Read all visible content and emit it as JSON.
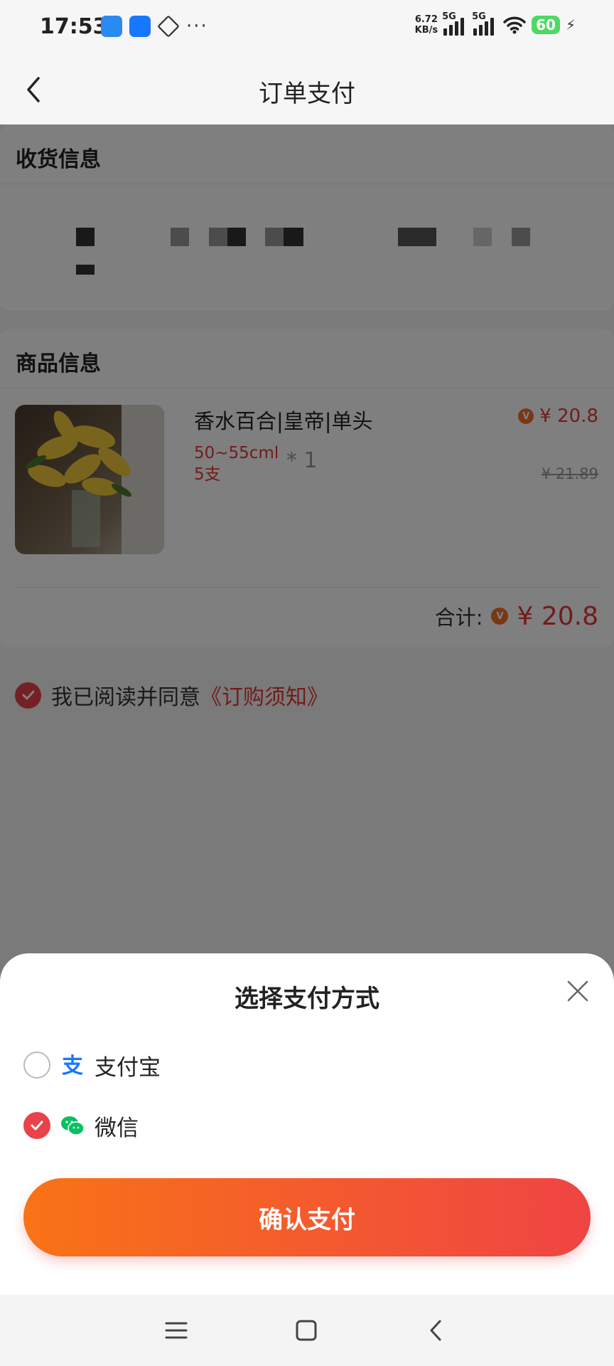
{
  "status_bar": {
    "time": "17:53",
    "net_speed_value": "6.72",
    "net_speed_unit": "KB/s",
    "sim1_label": "5G",
    "sim2_label": "5G",
    "battery": "60",
    "more_label": "···"
  },
  "nav": {
    "title": "订单支付"
  },
  "address_card": {
    "title": "收货信息"
  },
  "goods_card": {
    "title": "商品信息",
    "item": {
      "name": "香水百合|皇帝|单头",
      "spec_line1": "50~55cml",
      "spec_line2": "5支",
      "quantity": "* 1",
      "price": "¥ 20.8",
      "original_price": "¥ 21.89",
      "badge": "V"
    },
    "total_label": "合计:",
    "total_price": "¥ 20.8"
  },
  "agreement": {
    "text": "我已阅读并同意",
    "link": "《订购须知》",
    "checked": true
  },
  "payment_sheet": {
    "title": "选择支付方式",
    "options": [
      {
        "label": "支付宝",
        "icon": "alipay-icon",
        "selected": false
      },
      {
        "label": "微信",
        "icon": "wechat-icon",
        "selected": true
      }
    ],
    "confirm_label": "确认支付"
  },
  "colors": {
    "accent_red": "#e53935",
    "check_red": "#e8434a",
    "button_gradient_start": "#f97316",
    "button_gradient_end": "#ef4444",
    "alipay_blue": "#1677ff",
    "wechat_green": "#07c160"
  }
}
